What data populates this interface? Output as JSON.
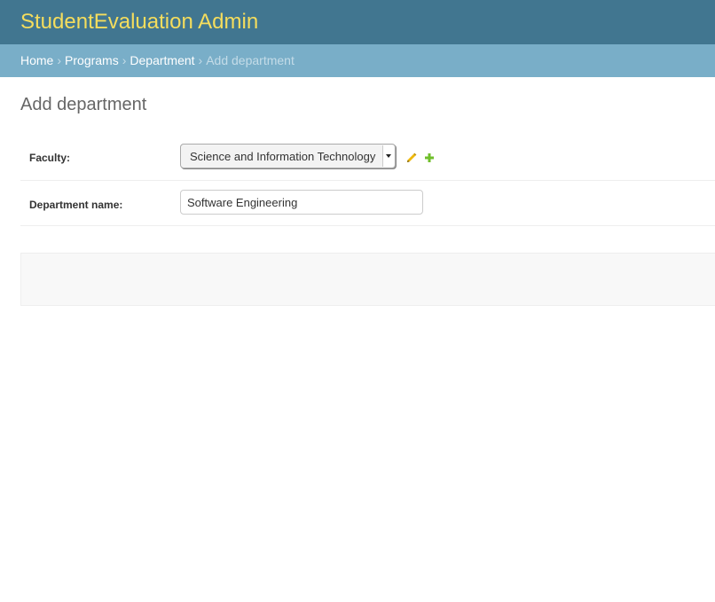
{
  "header": {
    "brand": "StudentEvaluation Admin"
  },
  "breadcrumbs": {
    "items": [
      "Home",
      "Programs",
      "Department"
    ],
    "separator": "›",
    "current": "Add department"
  },
  "page": {
    "title": "Add department"
  },
  "form": {
    "faculty": {
      "label": "Faculty:",
      "selected": "Science and Information Technology"
    },
    "department_name": {
      "label": "Department name:",
      "value": "Software Engineering"
    }
  },
  "icons": {
    "edit": "pencil-icon",
    "add": "plus-icon"
  },
  "colors": {
    "header_bg": "#417690",
    "brand_text": "#f5dd5d",
    "breadcrumb_bg": "#79aec8",
    "edit_icon": "#efb80b",
    "add_icon": "#70bf2b"
  }
}
